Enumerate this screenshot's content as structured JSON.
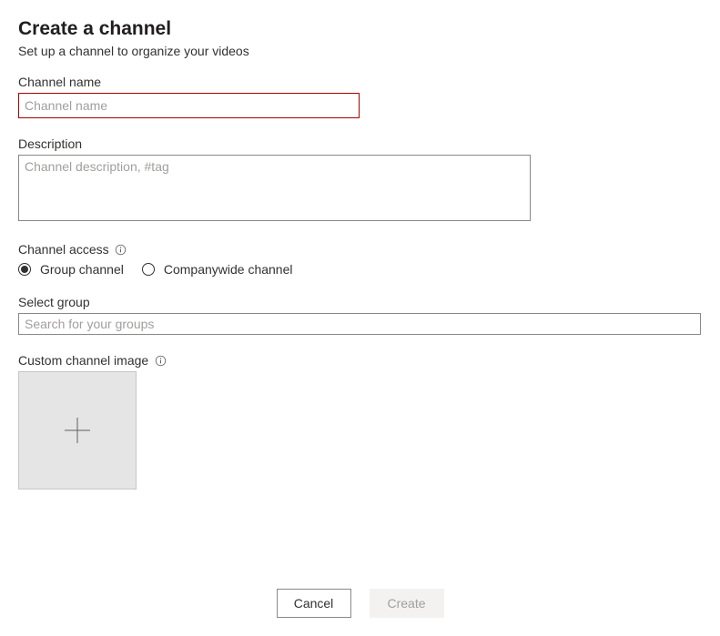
{
  "header": {
    "title": "Create a channel",
    "subtitle": "Set up a channel to organize your videos"
  },
  "channelName": {
    "label": "Channel name",
    "placeholder": "Channel name",
    "value": ""
  },
  "description": {
    "label": "Description",
    "placeholder": "Channel description, #tag",
    "value": ""
  },
  "channelAccess": {
    "label": "Channel access",
    "options": {
      "group": "Group channel",
      "companywide": "Companywide channel"
    },
    "selected": "group"
  },
  "selectGroup": {
    "label": "Select group",
    "placeholder": "Search for your groups",
    "value": ""
  },
  "customImage": {
    "label": "Custom channel image"
  },
  "buttons": {
    "cancel": "Cancel",
    "create": "Create"
  }
}
